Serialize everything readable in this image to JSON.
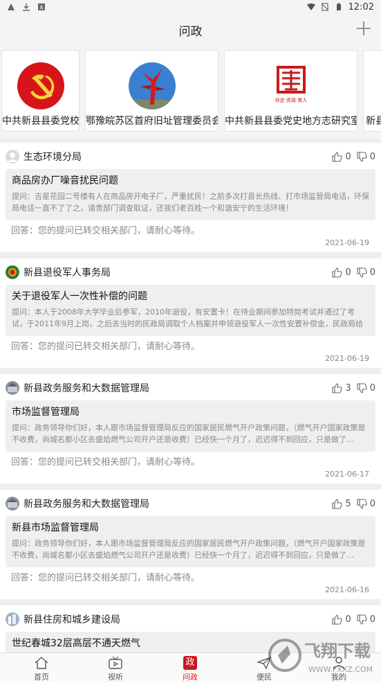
{
  "status_bar": {
    "time": "12:02"
  },
  "header": {
    "title": "问政"
  },
  "organizations": [
    {
      "name": "中共新县县委党校",
      "logo": "party-emblem"
    },
    {
      "name": "鄂豫皖苏区首府旧址管理委员会",
      "logo": "red-monument"
    },
    {
      "name": "中共新县县委党史地方志研究室",
      "logo": "red-seal",
      "logo_caption": "存史·资政·育人"
    },
    {
      "name": "新县",
      "logo": ""
    }
  ],
  "posts": [
    {
      "department": "生态环境分局",
      "avatar": "grey-avatar",
      "likes": "0",
      "dislikes": "0",
      "title": "商品房办厂噪音扰民问题",
      "body": "提问：吉星花园二号楼有人在商品房开电子厂，严重扰民！之前多次打县长热线、打市场监管局电话，环保局电话一直不了了之，请贵部门调查取证，还我们老百姓一个和谐安宁的生活环境！",
      "answer": "回答：您的提问已转交相关部门，请耐心等待。",
      "date": "2021-06-19"
    },
    {
      "department": "新县退役军人事务局",
      "avatar": "emblem-avatar",
      "likes": "0",
      "dislikes": "0",
      "title": "关于退役军人一次性补偿的问题",
      "body": "提问：本人于2008年大学毕业后参军，2010年退役，有安置卡！在待业期间参加特岗考试并通过了考试，于2011年9月上岗，之后去当时的民政局调取个人档案并申领退役军人一次性安置补偿金，民政局给的…",
      "answer": "回答：您的提问已转交相关部门，请耐心等待。",
      "date": "2021-06-19"
    },
    {
      "department": "新县政务服务和大数据管理局",
      "avatar": "building-avatar",
      "likes": "3",
      "dislikes": "0",
      "title": "市场监督管理局",
      "body": "提问：政务领导你们好，本人跟市场监督管理局反应的国家居民燃气开户政策问题，（燃气开户国家政策是不收费，尚城名都小区去盛焰燃气公司开户还是收费）已经快一个月了，迟迟得不到回应，只是做了…",
      "answer": "回答：您的提问已转交相关部门，请耐心等待。",
      "date": "2021-06-17"
    },
    {
      "department": "新县政务服务和大数据管理局",
      "avatar": "building-avatar",
      "likes": "5",
      "dislikes": "0",
      "title": "新县市场监督管理局",
      "body": "提问：政务领导你们好，本人跟市场监督管理局反应的国家居民燃气开户政策问题，（燃气开户国家政策是不收费，尚城名都小区去盛焰燃气公司开户还是收费）已经快一个月了，迟迟得不到回应，只是做了…",
      "answer": "回答：您的提问已转交相关部门，请耐心等待。",
      "date": "2021-06-16"
    },
    {
      "department": "新县住房和城乡建设局",
      "avatar": "city-avatar",
      "likes": "0",
      "dislikes": "0",
      "title": "世纪春城32层高层不通天燃气",
      "body": "",
      "answer": "",
      "date": ""
    }
  ],
  "tabs": [
    {
      "label": "首页",
      "icon": "home-icon"
    },
    {
      "label": "视听",
      "icon": "tv-icon"
    },
    {
      "label": "问政",
      "icon": "zheng-badge-icon",
      "badge_text": "政",
      "active": true
    },
    {
      "label": "便民",
      "icon": "send-icon"
    },
    {
      "label": "我的",
      "icon": "person-icon"
    }
  ],
  "watermark": {
    "text": "飞翔下载",
    "sub": "WWW.FXXZ.COM"
  },
  "colors": {
    "accent": "#c8191b",
    "background": "#eeeeee",
    "card": "#ffffff"
  }
}
